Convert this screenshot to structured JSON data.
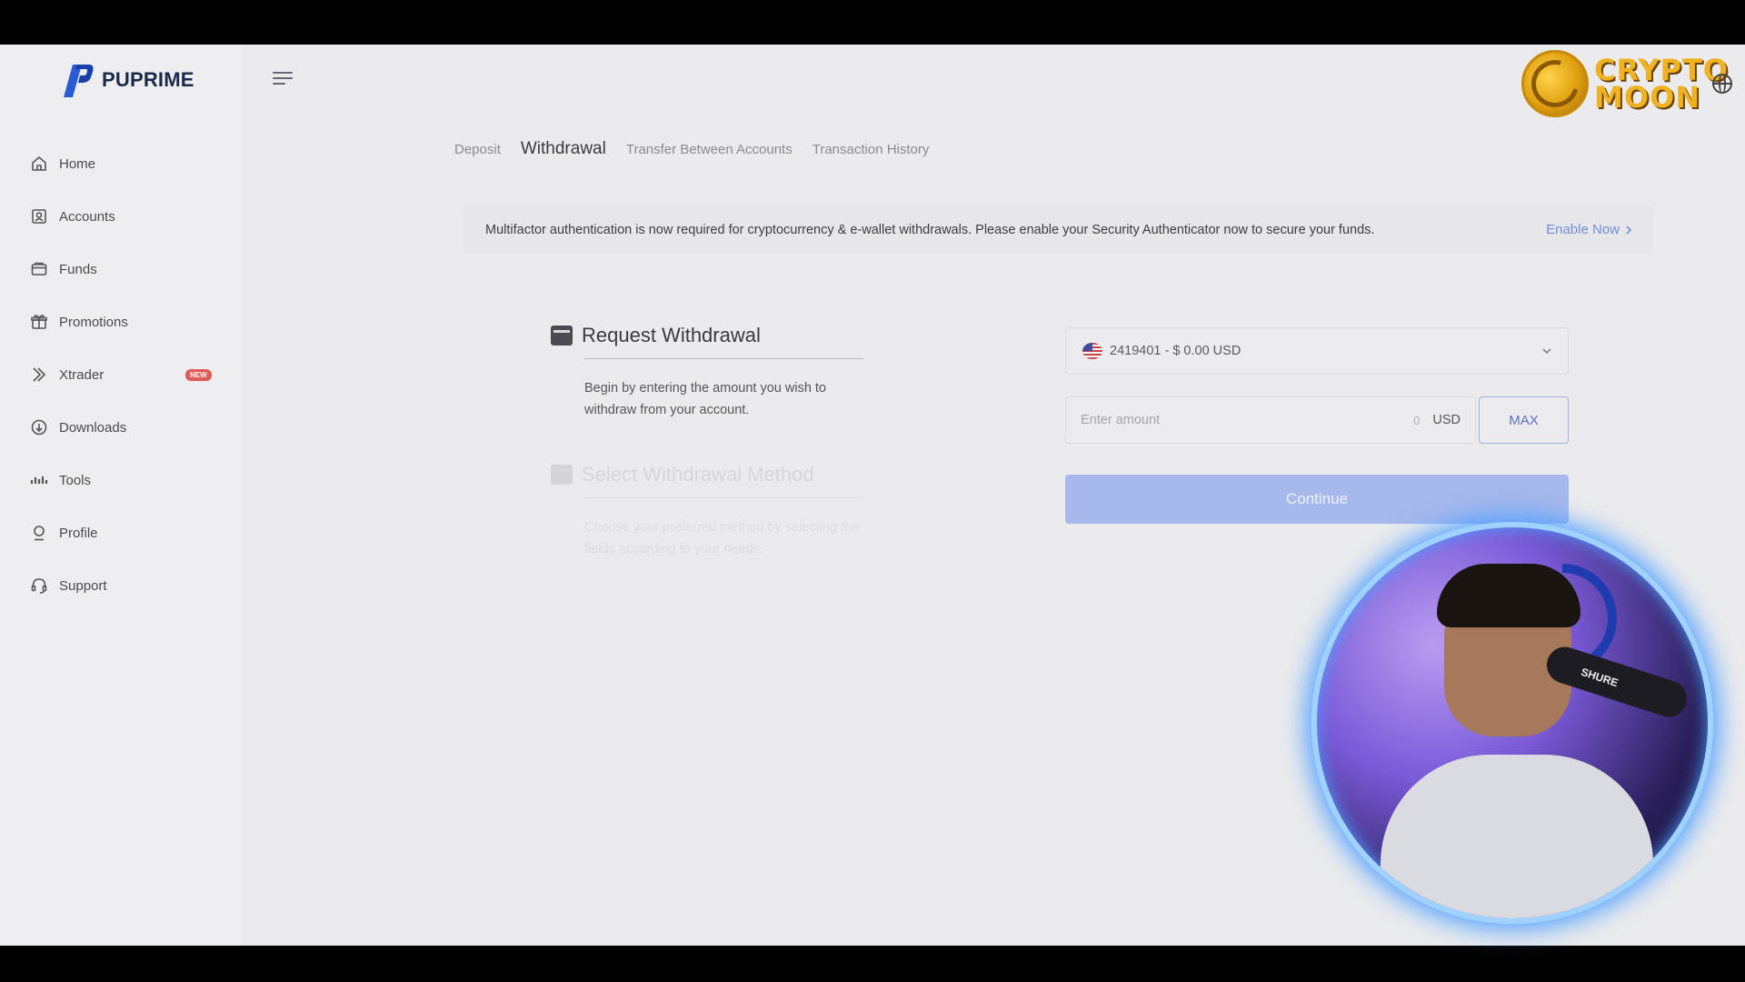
{
  "brand": {
    "name": "PUPRIME",
    "accent": "#2a5bd7"
  },
  "sidebar": {
    "items": [
      {
        "label": "Home",
        "icon": "home-icon"
      },
      {
        "label": "Accounts",
        "icon": "accounts-icon"
      },
      {
        "label": "Funds",
        "icon": "funds-icon"
      },
      {
        "label": "Promotions",
        "icon": "gift-icon"
      },
      {
        "label": "Xtrader",
        "icon": "xtrader-icon",
        "badge": "NEW"
      },
      {
        "label": "Downloads",
        "icon": "download-icon"
      },
      {
        "label": "Tools",
        "icon": "tools-icon"
      },
      {
        "label": "Profile",
        "icon": "profile-icon"
      },
      {
        "label": "Support",
        "icon": "headset-icon"
      }
    ]
  },
  "tabs": [
    {
      "label": "Deposit"
    },
    {
      "label": "Withdrawal",
      "active": true
    },
    {
      "label": "Transfer Between Accounts"
    },
    {
      "label": "Transaction History"
    }
  ],
  "notice": {
    "text": "Multifactor authentication is now required for cryptocurrency & e-wallet withdrawals. Please enable your Security Authenticator now to secure your funds.",
    "link": "Enable Now"
  },
  "steps": [
    {
      "title": "Request Withdrawal",
      "desc": "Begin by entering the amount you wish to withdraw from your account."
    },
    {
      "title": "Select Withdrawal Method",
      "desc": "Choose your preferred method by selecting the fields according to your needs."
    }
  ],
  "form": {
    "account_select": "2419401 - $ 0.00 USD",
    "amount_placeholder": "Enter amount",
    "amount_value": "",
    "amount_hint": "0",
    "currency": "USD",
    "max_label": "MAX",
    "continue_label": "Continue"
  },
  "overlay": {
    "channel_line1": "CRYPTO",
    "channel_line2": "MOON",
    "mic_label": "SHURE"
  }
}
